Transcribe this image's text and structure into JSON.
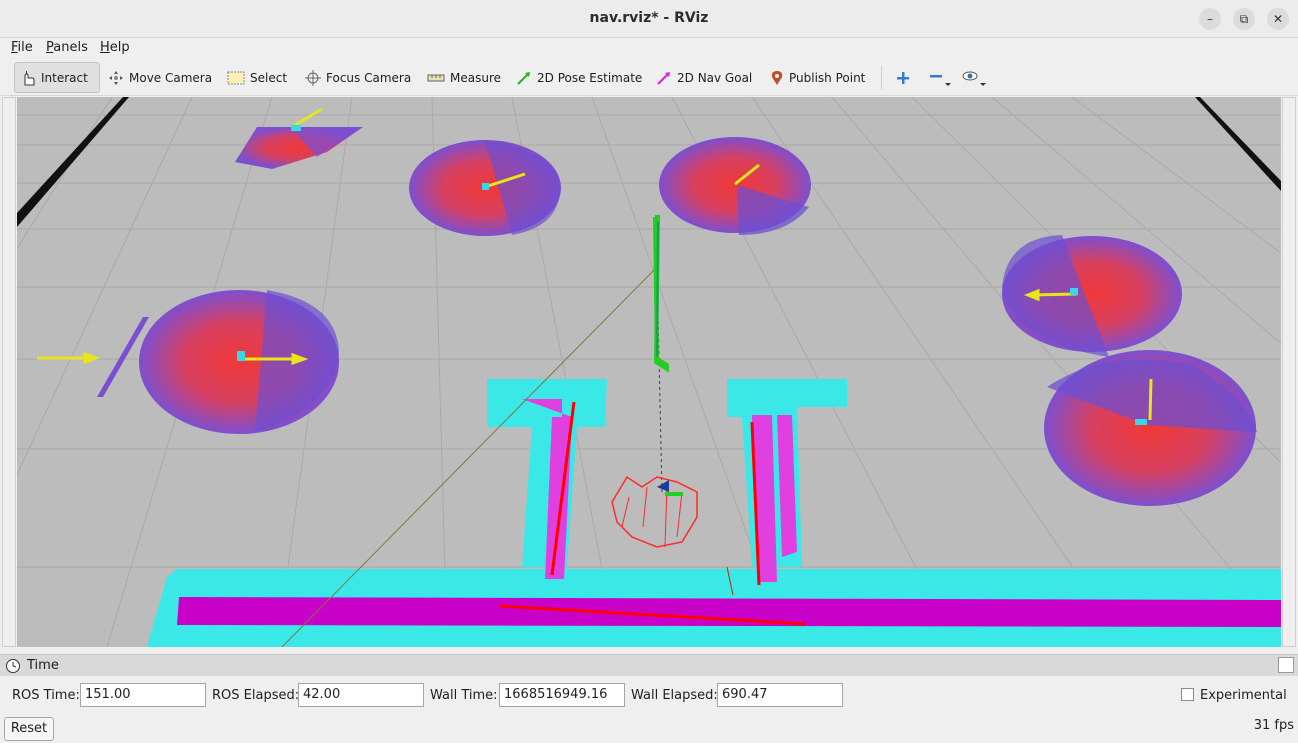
{
  "window": {
    "title": "nav.rviz* - RViz",
    "minimize": "–",
    "restore": "⧉",
    "close": "✕"
  },
  "menu": {
    "items": [
      {
        "mnemonic": "F",
        "rest": "ile"
      },
      {
        "mnemonic": "P",
        "rest": "anels"
      },
      {
        "mnemonic": "H",
        "rest": "elp"
      }
    ]
  },
  "toolbar": {
    "interact": "Interact",
    "move_camera": "Move Camera",
    "select": "Select",
    "focus_camera": "Focus Camera",
    "measure": "Measure",
    "pose_estimate": "2D Pose Estimate",
    "nav_goal": "2D Nav Goal",
    "publish_point": "Publish Point"
  },
  "time_panel": {
    "title": "Time",
    "ros_time_label": "ROS Time:",
    "ros_time": "151.00",
    "ros_elapsed_label": "ROS Elapsed:",
    "ros_elapsed": "42.00",
    "wall_time_label": "Wall Time:",
    "wall_time": "1668516949.16",
    "wall_elapsed_label": "Wall Elapsed:",
    "wall_elapsed": "690.47",
    "experimental_label": "Experimental",
    "reset": "Reset",
    "fps": "31 fps"
  },
  "colors": {
    "costmap_cyan": "#3ae8e8",
    "costmap_magenta": "#d400d4",
    "grid_bg": "#bcbcbc",
    "path_green": "#22cc22",
    "laser_red": "#ff0000"
  },
  "icons": [
    "interact-icon",
    "move-camera-icon",
    "select-icon",
    "focus-camera-icon",
    "measure-icon",
    "pose-estimate-icon",
    "nav-goal-icon",
    "publish-point-icon",
    "zoom-in-icon",
    "zoom-out-icon",
    "view-icon",
    "clock-icon"
  ]
}
